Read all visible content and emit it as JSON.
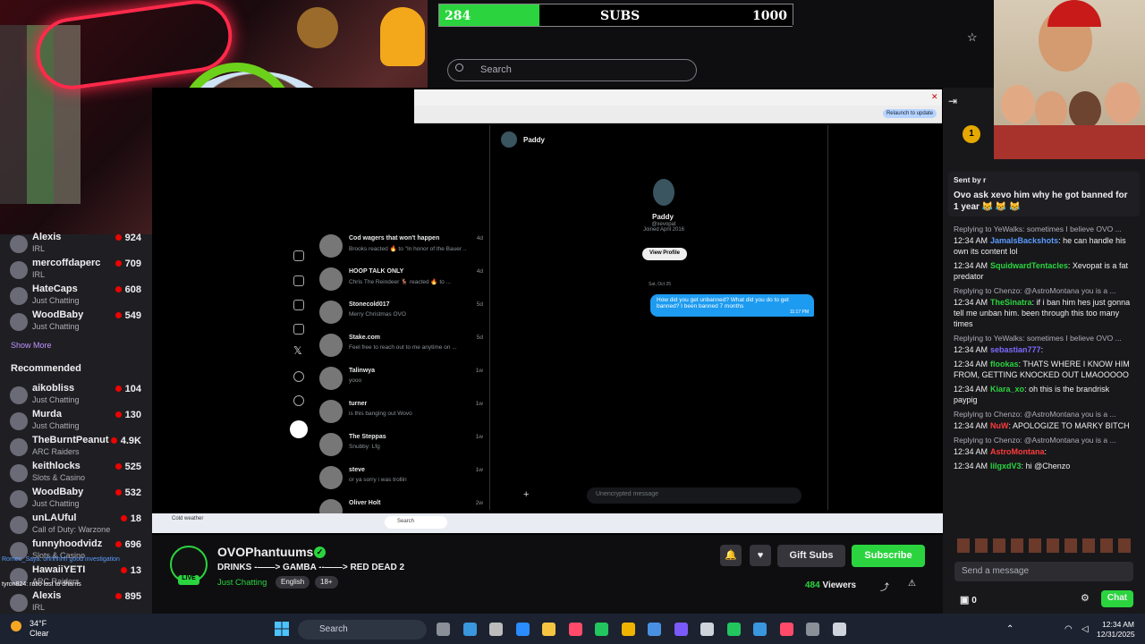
{
  "subs_bar": {
    "current": "284",
    "label": "SUBS",
    "goal": "1000",
    "progress": 0.284,
    "color": "#2bd43f"
  },
  "search": {
    "placeholder": "Search"
  },
  "sidebar": {
    "channels": [
      {
        "name": "Alexis",
        "category": "IRL",
        "viewers": "924"
      },
      {
        "name": "mercoffdaperc",
        "category": "IRL",
        "viewers": "709"
      },
      {
        "name": "HateCaps",
        "category": "Just Chatting",
        "viewers": "608"
      },
      {
        "name": "WoodBaby",
        "category": "Just Chatting",
        "viewers": "549"
      }
    ],
    "show_more": "Show More",
    "recommended_label": "Recommended",
    "recommended": [
      {
        "name": "aikobliss",
        "category": "Just Chatting",
        "viewers": "104"
      },
      {
        "name": "Murda",
        "category": "Just Chatting",
        "viewers": "130"
      },
      {
        "name": "TheBurntPeanut",
        "category": "ARC Raiders",
        "viewers": "4.9K"
      },
      {
        "name": "keithlocks",
        "category": "Slots & Casino",
        "viewers": "525"
      },
      {
        "name": "WoodBaby",
        "category": "Just Chatting",
        "viewers": "532"
      },
      {
        "name": "unLAUful",
        "category": "Call of Duty: Warzone",
        "viewers": "18"
      },
      {
        "name": "funnyhoodvidz",
        "category": "Slots & Casino",
        "viewers": "696"
      },
      {
        "name": "HawaiiYETI",
        "category": "ARC Raiders",
        "viewers": "13"
      },
      {
        "name": "Alexis",
        "category": "IRL",
        "viewers": "895"
      }
    ]
  },
  "stream_view": {
    "browser_button": "Relaunch to update",
    "dm_list": [
      {
        "name": "Cod wagers that won't happen",
        "preview": "Brooks reacted 🔥 to \"In honor of the Bauer ...",
        "time": "4d"
      },
      {
        "name": "HOOP TALK ONLY",
        "preview": "Chris The Reindeer 🦌 reacted 🔥 to ...",
        "time": "4d"
      },
      {
        "name": "Stonecold017",
        "preview": "Merry Christmas OVO",
        "time": "5d"
      },
      {
        "name": "Stake.com",
        "preview": "Feel free to reach out to me anytime on ...",
        "time": "5d"
      },
      {
        "name": "Talinwya",
        "preview": "yooo",
        "time": "1w"
      },
      {
        "name": "turner",
        "preview": "is this banging out Wovo",
        "time": "1w"
      },
      {
        "name": "The Steppas",
        "preview": "Snubby: Lfg",
        "time": "1w"
      },
      {
        "name": "steve",
        "preview": "or ya sorry i was trollin",
        "time": "1w"
      },
      {
        "name": "Oliver Holt",
        "preview": "",
        "time": "2w"
      }
    ],
    "conversation": {
      "name": "Paddy",
      "handle": "@xevopat",
      "joined": "Joined April 2016",
      "view_profile": "View Profile",
      "date": "Sat, Oct 25",
      "message": "How did you get unbanned? What did you do to get banned? I been banned 7 months",
      "message_time": "11:17 PM",
      "input_placeholder": "Unencrypted message"
    },
    "inner_taskbar_weather": "Cold weather",
    "inner_taskbar_search": "Search"
  },
  "channel": {
    "name": "OVOPhantuums",
    "live": "LIVE",
    "title": "DRINKS -——> GAMBA --——> RED DEAD 2",
    "category": "Just Chatting",
    "tags": [
      "English",
      "18+"
    ],
    "gift_label": "Gift Subs",
    "subscribe_label": "Subscribe",
    "viewers": "484",
    "viewers_label": "Viewers"
  },
  "chat": {
    "pinned_by": "Sent by r",
    "pinned_text": "Ovo ask xevo him why he got banned for 1 year 😹 😹 😹",
    "messages": [
      {
        "reply": "Replying to YeWalks: sometimes I believe OVO ...",
        "time": "12:34 AM",
        "user": "JamalsBackshots",
        "color": "#5b9bff",
        "text": "he can handle his own its content lol"
      },
      {
        "reply": "",
        "time": "12:34 AM",
        "user": "SquidwardTentacles",
        "color": "#2bd43f",
        "text": "Xevopat is a fat predator"
      },
      {
        "reply": "Replying to Chenzo: @AstroMontana you is a ...",
        "time": "12:34 AM",
        "user": "TheSinatra",
        "color": "#2bd43f",
        "text": "if i ban him hes just gonna tell me unban him. been through this too many times"
      },
      {
        "reply": "Replying to YeWalks: sometimes I believe OVO ...",
        "time": "12:34 AM",
        "user": "sebastian777",
        "color": "#7d6bff",
        "text": ""
      },
      {
        "reply": "",
        "time": "12:34 AM",
        "user": "flookas",
        "color": "#2bd43f",
        "text": "THATS WHERE I KNOW HIM FROM, GETTING KNOCKED OUT LMAOOOOO"
      },
      {
        "reply": "",
        "time": "12:34 AM",
        "user": "Kiara_xo",
        "color": "#2bd43f",
        "text": "oh this is the brandrisk paypig"
      },
      {
        "reply": "Replying to Chenzo: @AstroMontana you is a ...",
        "time": "12:34 AM",
        "user": "NuW",
        "color": "#ff3b3b",
        "text": "APOLOGIZE TO MARKY BITCH"
      },
      {
        "reply": "Replying to Chenzo: @AstroMontana you is a ...",
        "time": "12:34 AM",
        "user": "AstroMontana",
        "color": "#ff3b3b",
        "text": ""
      },
      {
        "reply": "",
        "time": "12:34 AM",
        "user": "lilgxdV3",
        "color": "#2bd43f",
        "text": "hi @Chenzo"
      }
    ],
    "send_placeholder": "Send a message",
    "points": "0",
    "chat_button": "Chat"
  },
  "taskbar": {
    "weather_temp": "34°F",
    "weather_desc": "Clear",
    "search_label": "Search",
    "time": "12:34 AM",
    "date": "12/31/2025"
  },
  "overlay": {
    "chat_line_1": "Romeo_Saya: ohhhhhh good investigation",
    "chat_line_2": "tyron824: ratio lost to dharris"
  }
}
